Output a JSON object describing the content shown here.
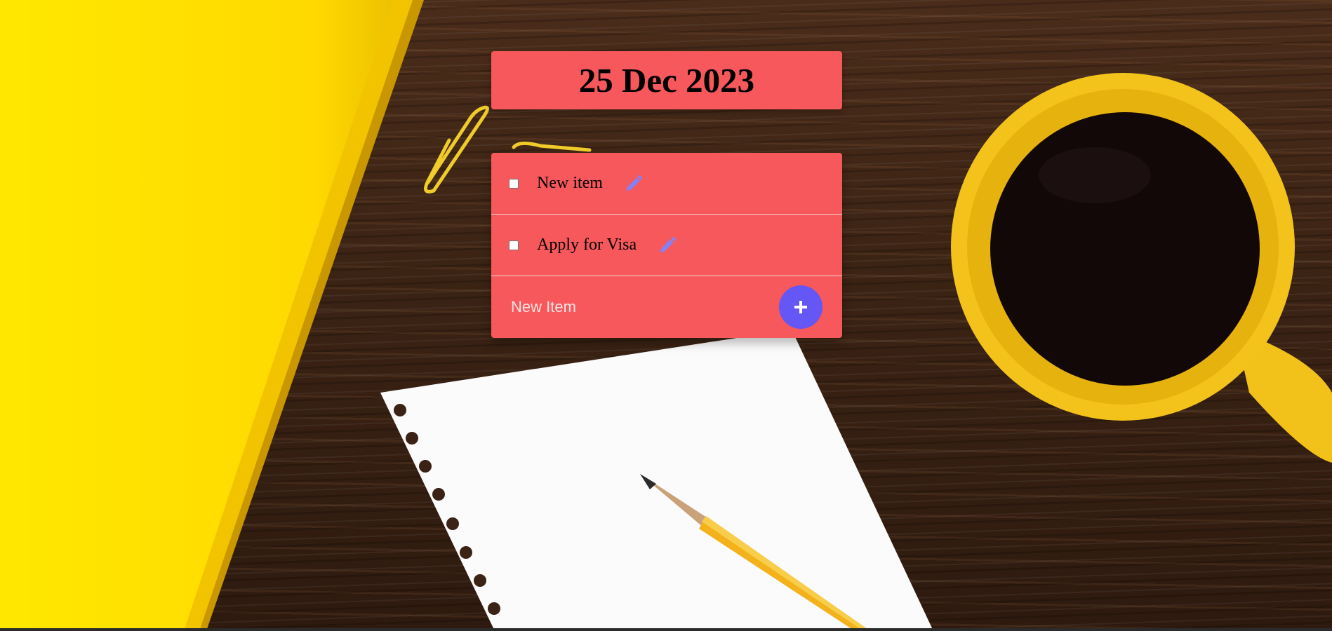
{
  "header": {
    "date": "25 Dec 2023"
  },
  "items": [
    {
      "label": "New item",
      "checked": false
    },
    {
      "label": "Apply for Visa",
      "checked": false
    }
  ],
  "new_item": {
    "placeholder": "New Item",
    "value": ""
  },
  "add_button": {
    "symbol": "+",
    "icon": "plus-icon"
  },
  "edit_icon": "pencil-icon",
  "colors": {
    "card": "#f6585b",
    "accent": "#6557f5",
    "pencil_icon": "#8a7ff0"
  }
}
